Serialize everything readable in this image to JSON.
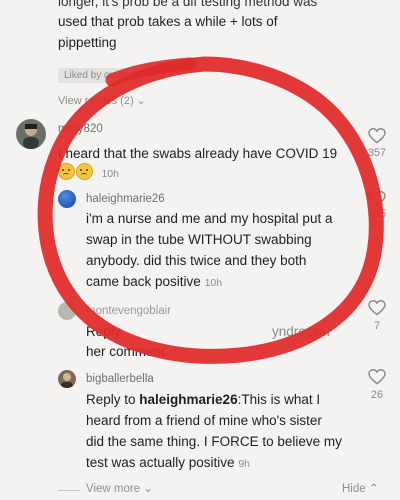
{
  "top_comment": {
    "line1": "longer, it's prob be a dif testing method was",
    "line2": "used that prob takes a while + lots of",
    "line3": "pippetting",
    "liked_by": "Liked by creator",
    "view_replies": "View replies (2)"
  },
  "comments": [
    {
      "username": "m4ry820",
      "text": "I heard that the swabs already have COVID 19",
      "time": "10h",
      "likes": "357"
    },
    {
      "username": "haleighmarie26",
      "text_lines": [
        "i'm a nurse and me and my hospital put a",
        "swap in the tube WITHOUT swabbing",
        "anybody. did this twice and they both",
        "came back positive"
      ],
      "time": "10h",
      "likes": "455"
    },
    {
      "username": "montevengoblair",
      "text_prefix": "Reply",
      "text_hidden_tail": "yndresser",
      "text_line2": "her comment",
      "time": "10h",
      "likes": "7"
    },
    {
      "username": "bigballerbella",
      "reply_prefix": "Reply to ",
      "reply_target": "haleighmarie26",
      "text_line1_rest": ":This is what I",
      "text_lines": [
        "heard from a friend of mine who's sister",
        "did the same thing. I FORCE to believe my",
        "test was actually positive"
      ],
      "time": "9h",
      "likes": "26"
    }
  ],
  "footer": {
    "view_more": "View more",
    "hide": "Hide"
  },
  "colors": {
    "background": "#f4f3f1",
    "annotation_circle": "#e02a2a",
    "text": "#1f1f1f",
    "muted": "#8e8e8e"
  }
}
